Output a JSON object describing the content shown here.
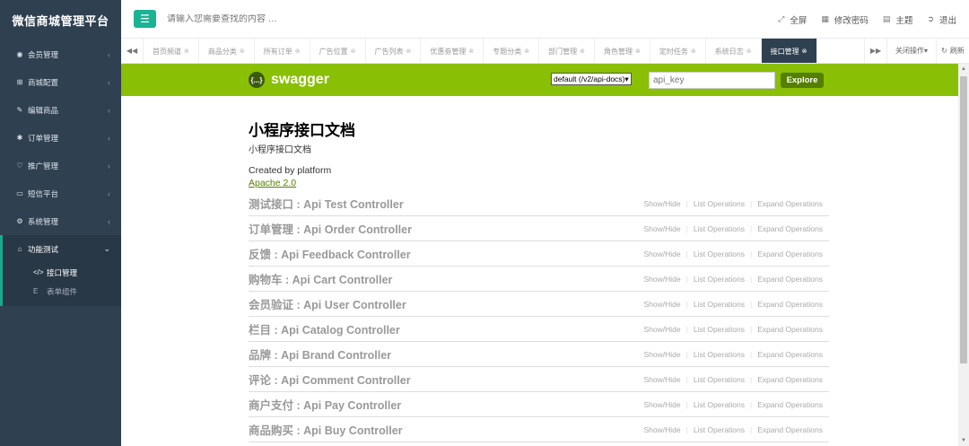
{
  "app": {
    "title": "微信商城管理平台"
  },
  "sidebar": {
    "items": [
      {
        "label": "会员管理",
        "icon": "user-circle-icon"
      },
      {
        "label": "商城配置",
        "icon": "cart-icon"
      },
      {
        "label": "编辑商品",
        "icon": "edit-icon"
      },
      {
        "label": "订单管理",
        "icon": "gear-icon"
      },
      {
        "label": "推广管理",
        "icon": "thumbs-up-icon"
      },
      {
        "label": "短信平台",
        "icon": "desktop-icon"
      },
      {
        "label": "系统管理",
        "icon": "cog-icon"
      }
    ],
    "active_group": {
      "label": "功能测试",
      "icon": "home-icon",
      "children": [
        {
          "label": "接口管理",
          "icon": "code-icon"
        },
        {
          "label": "表单组件",
          "icon": "form-icon"
        }
      ]
    }
  },
  "header": {
    "search_placeholder": "请输入您需要查找的内容 …",
    "fullscreen": "全屏",
    "change_password": "修改密码",
    "theme": "主题",
    "logout": "退出"
  },
  "tabs": {
    "items": [
      {
        "label": "首页频道",
        "active": false
      },
      {
        "label": "商品分类",
        "active": false
      },
      {
        "label": "所有订单",
        "active": false
      },
      {
        "label": "广告位置",
        "active": false
      },
      {
        "label": "广告列表",
        "active": false
      },
      {
        "label": "优惠劵管理",
        "active": false
      },
      {
        "label": "专题分类",
        "active": false
      },
      {
        "label": "部门管理",
        "active": false
      },
      {
        "label": "角色管理",
        "active": false
      },
      {
        "label": "定时任务",
        "active": false
      },
      {
        "label": "系统日志",
        "active": false
      },
      {
        "label": "接口管理",
        "active": true
      }
    ],
    "close_ops": "关闭操作",
    "refresh": "刷新"
  },
  "swagger": {
    "logo_text": "swagger",
    "logo_mark": "{...}",
    "spec_select": "default (/v2/api-docs)",
    "api_key_placeholder": "api_key",
    "explore_label": "Explore",
    "brand_color": "#89bf04",
    "title": "小程序接口文档",
    "description": "小程序接口文档",
    "created_by": "Created by platform",
    "license": "Apache 2.0",
    "op_show_hide": "Show/Hide",
    "op_list": "List Operations",
    "op_expand": "Expand Operations",
    "resources": [
      {
        "name": "测试接口 : Api Test Controller"
      },
      {
        "name": "订单管理 : Api Order Controller"
      },
      {
        "name": "反馈 : Api Feedback Controller"
      },
      {
        "name": "购物车 : Api Cart Controller"
      },
      {
        "name": "会员验证 : Api User Controller"
      },
      {
        "name": "栏目 : Api Catalog Controller"
      },
      {
        "name": "品牌 : Api Brand Controller"
      },
      {
        "name": "评论 : Api Comment Controller"
      },
      {
        "name": "商户支付 : Api Pay Controller"
      },
      {
        "name": "商品购买 : Api Buy Controller"
      }
    ]
  },
  "colors": {
    "sidebar_bg": "#2f4050",
    "accent": "#1ab394",
    "swagger_green": "#89bf04",
    "explore_btn": "#547f00"
  }
}
